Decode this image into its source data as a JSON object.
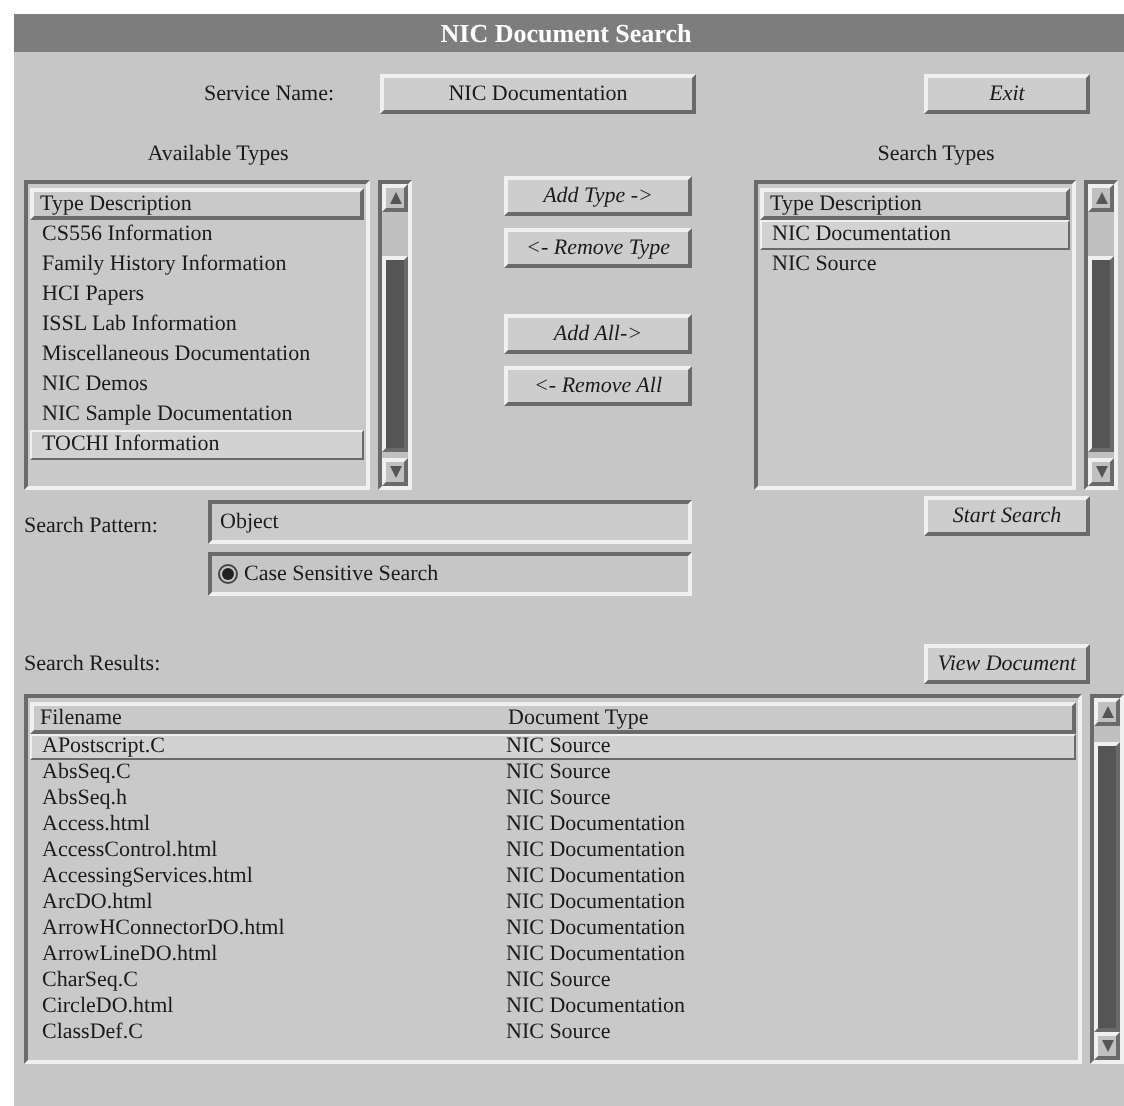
{
  "window": {
    "title": "NIC Document Search"
  },
  "service": {
    "label": "Service Name:",
    "value": "NIC Documentation"
  },
  "exit_button": "Exit",
  "available_types": {
    "title": "Available Types",
    "header": "Type Description",
    "items": [
      {
        "label": "CS556 Information",
        "selected": false
      },
      {
        "label": "Family History Information",
        "selected": false
      },
      {
        "label": "HCI Papers",
        "selected": false
      },
      {
        "label": "ISSL Lab Information",
        "selected": false
      },
      {
        "label": "Miscellaneous Documentation",
        "selected": false
      },
      {
        "label": "NIC Demos",
        "selected": false
      },
      {
        "label": "NIC Sample Documentation",
        "selected": false
      },
      {
        "label": "TOCHI Information",
        "selected": true
      }
    ]
  },
  "transfer_buttons": [
    "Add Type ->",
    "<- Remove Type",
    "Add All->",
    "<- Remove All"
  ],
  "search_types": {
    "title": "Search Types",
    "header": "Type Description",
    "items": [
      {
        "label": "NIC Documentation",
        "selected": true
      },
      {
        "label": "NIC Source",
        "selected": false
      }
    ]
  },
  "search_pattern": {
    "label": "Search Pattern:",
    "value": "Object"
  },
  "case_sensitive": {
    "label": "Case Sensitive Search",
    "checked": true
  },
  "start_search_button": "Start Search",
  "results": {
    "label": "Search Results:",
    "view_button": "View Document",
    "columns": [
      "Filename",
      "Document Type"
    ],
    "rows": [
      {
        "cells": [
          "APostscript.C",
          "NIC Source"
        ],
        "selected": true
      },
      {
        "cells": [
          "AbsSeq.C",
          "NIC Source"
        ],
        "selected": false
      },
      {
        "cells": [
          "AbsSeq.h",
          "NIC Source"
        ],
        "selected": false
      },
      {
        "cells": [
          "Access.html",
          "NIC Documentation"
        ],
        "selected": false
      },
      {
        "cells": [
          "AccessControl.html",
          "NIC Documentation"
        ],
        "selected": false
      },
      {
        "cells": [
          "AccessingServices.html",
          "NIC Documentation"
        ],
        "selected": false
      },
      {
        "cells": [
          "ArcDO.html",
          "NIC Documentation"
        ],
        "selected": false
      },
      {
        "cells": [
          "ArrowHConnectorDO.html",
          "NIC Documentation"
        ],
        "selected": false
      },
      {
        "cells": [
          "ArrowLineDO.html",
          "NIC Documentation"
        ],
        "selected": false
      },
      {
        "cells": [
          "CharSeq.C",
          "NIC Source"
        ],
        "selected": false
      },
      {
        "cells": [
          "CircleDO.html",
          "NIC Documentation"
        ],
        "selected": false
      },
      {
        "cells": [
          "ClassDef.C",
          "NIC Source"
        ],
        "selected": false
      }
    ]
  }
}
